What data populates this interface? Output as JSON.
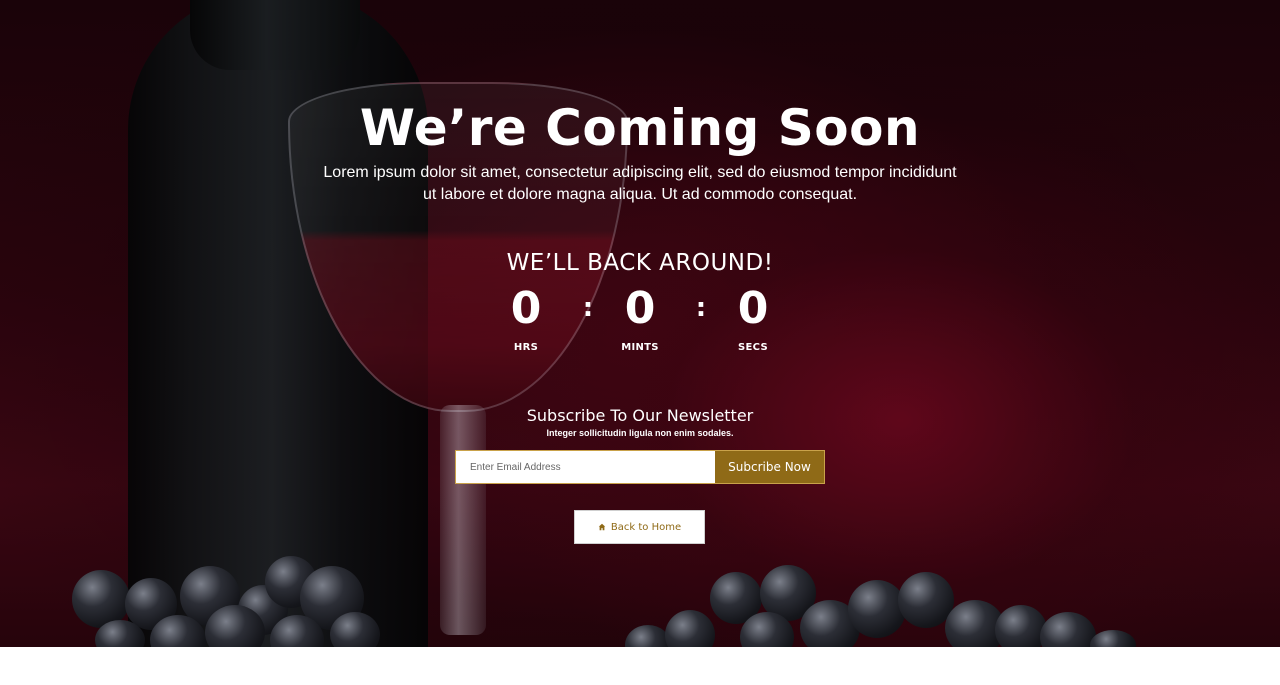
{
  "hero": {
    "title": "We’re Coming Soon",
    "description": "Lorem ipsum dolor sit amet, consectetur adipiscing elit, sed do eiusmod tempor incididunt ut labore et dolore magna aliqua. Ut ad commodo consequat."
  },
  "countdown": {
    "heading": "WE’LL BACK AROUND!",
    "hours": {
      "value": "0",
      "label": "HRS"
    },
    "minutes": {
      "value": "0",
      "label": "MINTS"
    },
    "seconds": {
      "value": "0",
      "label": "SECS"
    },
    "separator": ":"
  },
  "newsletter": {
    "title": "Subscribe To Our Newsletter",
    "subtitle": "Integer sollicitudin ligula non enim sodales.",
    "email_placeholder": "Enter Email Address",
    "email_value": "",
    "submit_label": "Subcribe Now"
  },
  "home_button": {
    "label": "Back to Home",
    "icon": "home-icon"
  },
  "colors": {
    "accent": "#8f6a17",
    "background": "#2a040d",
    "text": "#ffffff"
  }
}
